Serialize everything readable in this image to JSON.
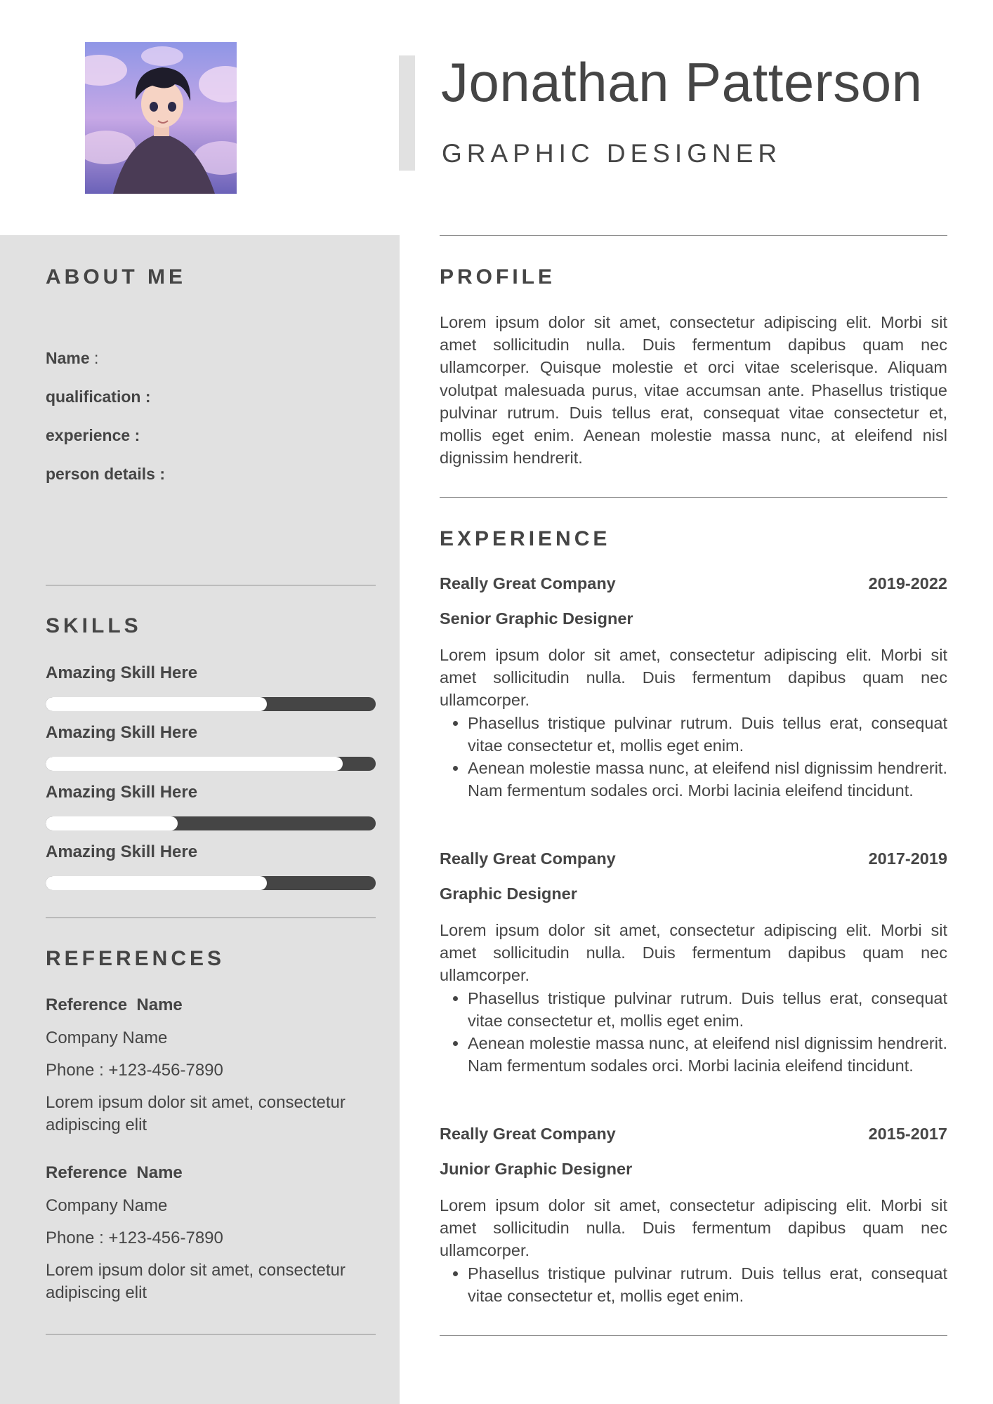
{
  "header": {
    "name": "Jonathan Patterson",
    "title": "GRAPHIC DESIGNER"
  },
  "about": {
    "heading": "ABOUT ME",
    "fields": [
      {
        "label": "Name",
        "sep": " :"
      },
      {
        "label": "qualification :",
        "sep": ""
      },
      {
        "label": "experience :",
        "sep": ""
      },
      {
        "label": "person details :",
        "sep": ""
      }
    ]
  },
  "skills": {
    "heading": "SKILLS",
    "items": [
      {
        "label": "Amazing Skill Here",
        "level": 0.67
      },
      {
        "label": "Amazing Skill Here",
        "level": 0.9
      },
      {
        "label": "Amazing Skill Here",
        "level": 0.4
      },
      {
        "label": "Amazing Skill Here",
        "level": 0.67
      }
    ]
  },
  "references": {
    "heading": "REFERENCES",
    "items": [
      {
        "name": "Reference  Name",
        "company": "Company Name",
        "phone": "Phone : +123-456-7890",
        "note": "Lorem ipsum dolor sit amet, consectetur adipiscing elit"
      },
      {
        "name": "Reference  Name",
        "company": "Company Name",
        "phone": "Phone : +123-456-7890",
        "note": "Lorem ipsum dolor sit amet, consectetur adipiscing elit"
      }
    ]
  },
  "profile": {
    "heading": "PROFILE",
    "text": "Lorem ipsum dolor sit amet, consectetur adipiscing elit. Morbi sit amet sollicitudin nulla. Duis fermentum dapibus quam nec ullamcorper. Quisque molestie et orci vitae scelerisque. Aliquam volutpat malesuada purus, vitae accumsan ante. Phasellus tristique pulvinar rutrum. Duis tellus erat, consequat vitae consectetur et, mollis eget enim. Aenean molestie massa nunc, at eleifend nisl dignissim hendrerit."
  },
  "experience": {
    "heading": "EXPERIENCE",
    "jobs": [
      {
        "company": "Really Great Company",
        "years": "2019-2022",
        "role": "Senior Graphic Designer",
        "summary": "Lorem ipsum dolor sit amet, consectetur adipiscing elit. Morbi sit amet sollicitudin nulla. Duis fermentum dapibus quam nec ullamcorper.",
        "bullets": [
          "Phasellus tristique pulvinar rutrum. Duis tellus erat, consequat vitae consectetur et, mollis eget enim.",
          "Aenean molestie massa nunc, at eleifend nisl dignissim hendrerit. Nam fermentum sodales orci. Morbi lacinia eleifend tincidunt."
        ]
      },
      {
        "company": "Really Great Company",
        "years": "2017-2019",
        "role": "Graphic Designer",
        "summary": "Lorem ipsum dolor sit amet, consectetur adipiscing elit. Morbi sit amet sollicitudin nulla. Duis fermentum dapibus quam nec ullamcorper.",
        "bullets": [
          "Phasellus tristique pulvinar rutrum. Duis tellus erat, consequat vitae consectetur et, mollis eget enim.",
          "Aenean molestie massa nunc, at eleifend nisl dignissim hendrerit. Nam fermentum sodales orci. Morbi lacinia eleifend tincidunt."
        ]
      },
      {
        "company": "Really Great Company",
        "years": "2015-2017",
        "role": "Junior Graphic Designer",
        "summary": "Lorem ipsum dolor sit amet, consectetur adipiscing elit. Morbi sit amet sollicitudin nulla. Duis fermentum dapibus quam nec ullamcorper.",
        "bullets": [
          "Phasellus tristique pulvinar rutrum. Duis tellus erat, consequat vitae consectetur et, mollis eget enim."
        ]
      }
    ]
  },
  "colors": {
    "text": "#454545",
    "sidebar": "#e1e1e1",
    "divider": "#8e8e8e",
    "skill_track": "#454545",
    "skill_fill": "#ffffff"
  }
}
